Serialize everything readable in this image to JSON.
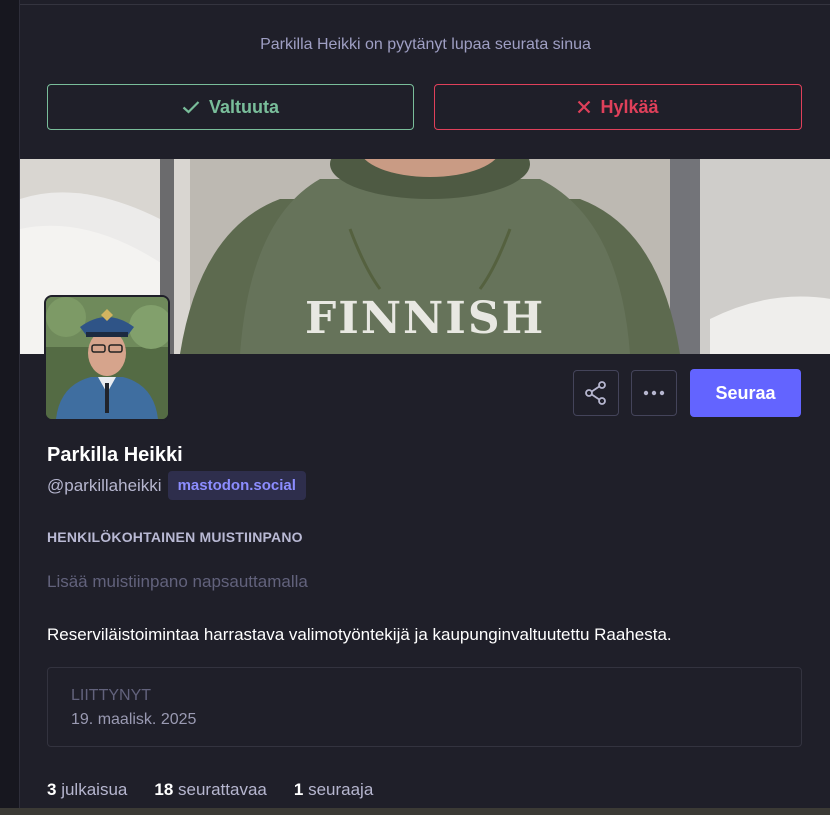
{
  "follow_request": {
    "message": "Parkilla Heikki on pyytänyt lupaa seurata sinua",
    "approve_label": "Valtuuta",
    "reject_label": "Hylkää"
  },
  "header_image": {
    "shirt_text": "FINNISH"
  },
  "profile": {
    "display_name": "Parkilla Heikki",
    "handle": "@parkillaheikki",
    "domain": "mastodon.social",
    "follow_label": "Seuraa",
    "note_label": "HENKILÖKOHTAINEN MUISTIINPANO",
    "note_placeholder": "Lisää muistiinpano napsauttamalla",
    "bio": "Reserviläistoimintaa harrastava valimotyöntekijä ja kaupunginvaltuutettu Raahesta.",
    "joined_label": "LIITTYNYT",
    "joined_date": "19. maalisk. 2025"
  },
  "stats": {
    "posts_count": "3",
    "posts_label": "julkaisua",
    "following_count": "18",
    "following_label": "seurattavaa",
    "followers_count": "1",
    "followers_label": "seuraaja"
  },
  "colors": {
    "accent": "#6364ff",
    "approve": "#79bd9a",
    "reject": "#df405a",
    "background": "#1f1f29"
  },
  "icons": [
    "check-icon",
    "close-icon",
    "share-icon",
    "more-icon"
  ]
}
